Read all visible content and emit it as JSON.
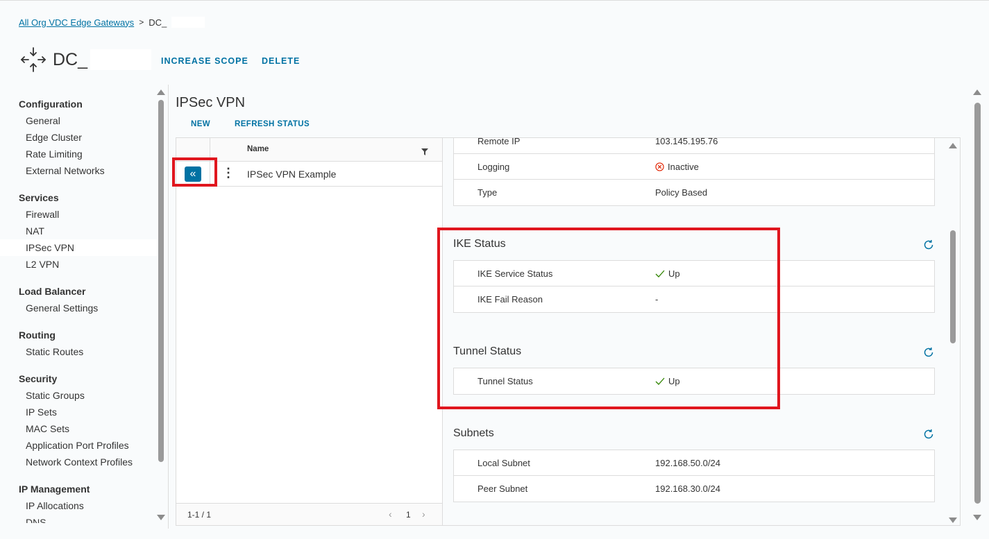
{
  "breadcrumb": {
    "parent": "All Org VDC Edge Gateways",
    "separator": ">",
    "current": "DC_"
  },
  "header": {
    "title": "DC_",
    "actions": [
      "INCREASE SCOPE",
      "DELETE"
    ]
  },
  "sidebar": {
    "groups": [
      {
        "label": "Configuration",
        "items": [
          "General",
          "Edge Cluster",
          "Rate Limiting",
          "External Networks"
        ]
      },
      {
        "label": "Services",
        "items": [
          "Firewall",
          "NAT",
          "IPSec VPN",
          "L2 VPN"
        ]
      },
      {
        "label": "Load Balancer",
        "items": [
          "General Settings"
        ]
      },
      {
        "label": "Routing",
        "items": [
          "Static Routes"
        ]
      },
      {
        "label": "Security",
        "items": [
          "Static Groups",
          "IP Sets",
          "MAC Sets",
          "Application Port Profiles",
          "Network Context Profiles"
        ]
      },
      {
        "label": "IP Management",
        "items": [
          "IP Allocations",
          "DNS"
        ]
      }
    ],
    "active_item": "IPSec VPN"
  },
  "page": {
    "title": "IPSec VPN",
    "toolbar": {
      "new": "NEW",
      "refresh_status": "REFRESH STATUS"
    }
  },
  "grid": {
    "column_name": "Name",
    "rows": [
      {
        "name": "IPSec VPN Example"
      }
    ],
    "footer": {
      "range": "1-1 / 1",
      "page": "1"
    }
  },
  "detail": {
    "top_rows": [
      {
        "key": "Remote IP",
        "value": "103.145.195.76"
      },
      {
        "key": "Logging",
        "value": "Inactive",
        "status": "inactive"
      },
      {
        "key": "Type",
        "value": "Policy Based"
      }
    ],
    "ike_status": {
      "title": "IKE Status",
      "rows": [
        {
          "key": "IKE Service Status",
          "value": "Up",
          "status": "up"
        },
        {
          "key": "IKE Fail Reason",
          "value": "-"
        }
      ]
    },
    "tunnel_status": {
      "title": "Tunnel Status",
      "rows": [
        {
          "key": "Tunnel Status",
          "value": "Up",
          "status": "up"
        }
      ]
    },
    "subnets": {
      "title": "Subnets",
      "rows": [
        {
          "key": "Local Subnet",
          "value": "192.168.50.0/24"
        },
        {
          "key": "Peer Subnet",
          "value": "192.168.30.0/24"
        }
      ]
    }
  },
  "colors": {
    "accent": "#0072a3",
    "highlight": "#e0161e",
    "status_up": "#2f8400",
    "status_inactive": "#e12200"
  }
}
